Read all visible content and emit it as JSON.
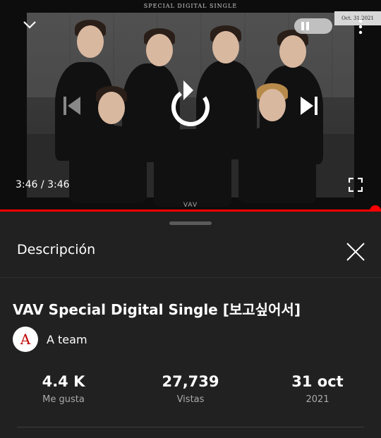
{
  "player": {
    "banner": "SPECIAL DIGITAL SINGLE",
    "date_tag": "Oct. 31.2021",
    "time_current": "3:46",
    "time_separator": "/",
    "time_total": "3:46",
    "watermark": "VAV",
    "progress": 1.0,
    "accent_color": "#ff0000"
  },
  "description": {
    "header": "Descripción",
    "video_title": "VAV Special Digital Single [보고싶어서]",
    "channel_name": "A team",
    "stats": [
      {
        "value": "4.4 K",
        "label": "Me gusta"
      },
      {
        "value": "27,739",
        "label": "Vistas"
      },
      {
        "value": "31 oct",
        "label": "2021"
      }
    ]
  }
}
